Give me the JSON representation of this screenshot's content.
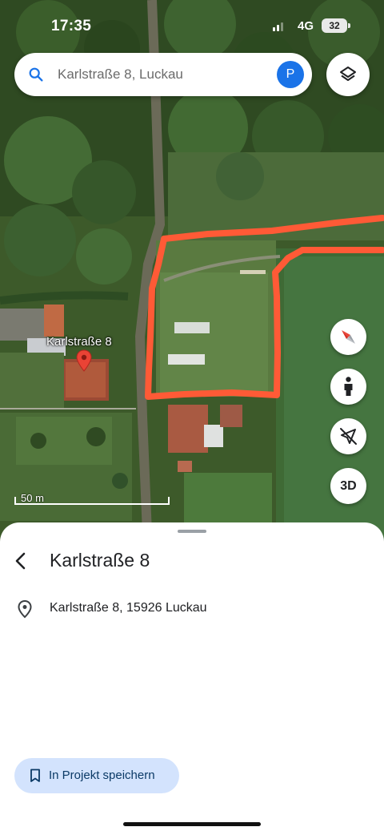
{
  "status_bar": {
    "time": "17:35",
    "network": "4G",
    "battery": "32"
  },
  "search": {
    "query": "Karlstraße 8, Luckau",
    "avatar_letter": "P",
    "icon": "search-icon"
  },
  "map": {
    "place_label": "Karlstraße 8",
    "scale_label": "50 m",
    "annotation_color": "#ff5a36",
    "controls": {
      "compass": "compass-icon",
      "street_view": "pegman-icon",
      "location": "location-off-icon",
      "three_d": "3D",
      "layers": "layers-icon"
    }
  },
  "sheet": {
    "title": "Karlstraße 8",
    "address": "Karlstraße 8, 15926 Luckau",
    "save_button": "In Projekt speichern",
    "accent": "#d3e3fd"
  }
}
